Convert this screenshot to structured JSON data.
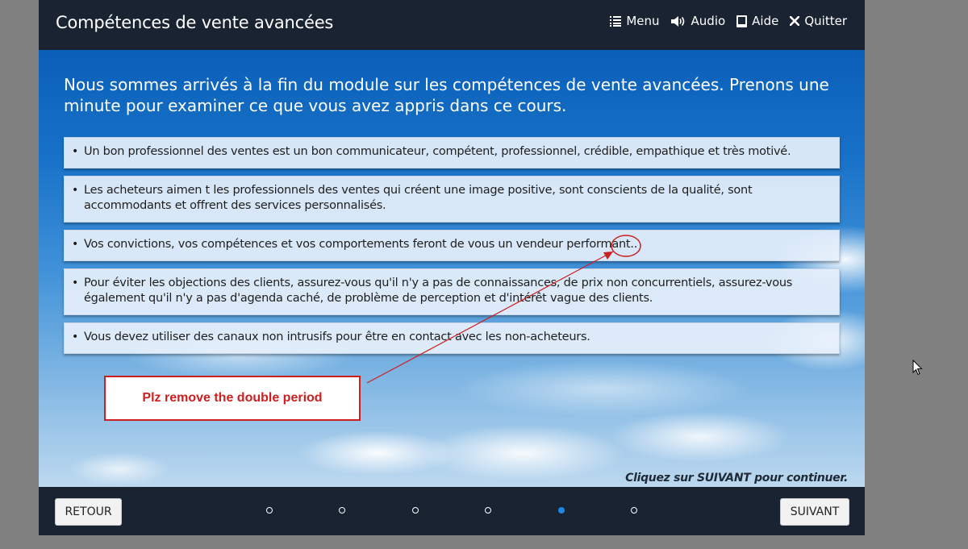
{
  "header": {
    "title": "Compétences de vente avancées",
    "nav": [
      {
        "label": "Menu",
        "icon": "menu-icon"
      },
      {
        "label": "Audio",
        "icon": "speaker-icon"
      },
      {
        "label": "Aide",
        "icon": "book-icon"
      },
      {
        "label": "Quitter",
        "icon": "close-icon"
      }
    ]
  },
  "slide": {
    "heading": "Nous sommes arrivés à la fin du module sur les compétences de vente avancées. Prenons une minute pour examiner ce que vous avez appris dans ce cours.",
    "bullets": [
      "Un bon professionnel des ventes est un bon communicateur, compétent, professionnel, crédible, empathique et très motivé.",
      "Les acheteurs aimen t les professionnels des ventes qui créent une image positive, sont conscients de la qualité, sont accommodants et offrent des services personnalisés.",
      "Vos convictions, vos compétences et vos comportements feront de vous un vendeur performant..",
      "Pour éviter les objections des clients, assurez-vous qu'il n'y a pas de connaissances, de prix non concurrentiels, assurez-vous également qu'il n'y a pas d'agenda caché, de problème de perception et d'intérêt vague des clients.",
      "Vous devez utiliser des canaux non intrusifs pour être en contact avec les non-acheteurs."
    ],
    "hint": "Cliquez sur SUIVANT pour continuer."
  },
  "annotation": {
    "text": "Plz remove the double period",
    "color": "#cc1f1f"
  },
  "footer": {
    "back_label": "RETOUR",
    "next_label": "SUIVANT",
    "page_count": 6,
    "current_page": 5
  },
  "colors": {
    "bar": "#1a2331",
    "active_dot": "#1e86e3"
  }
}
